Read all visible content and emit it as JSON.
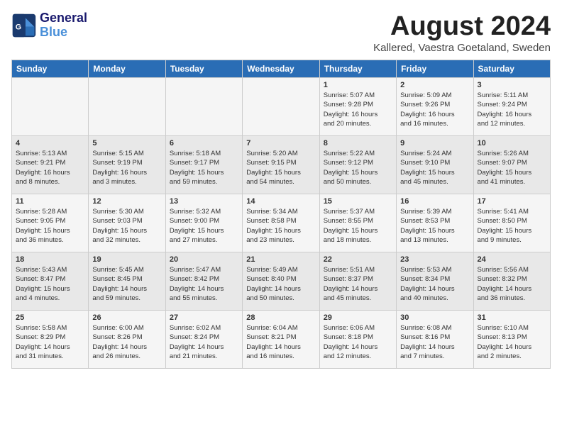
{
  "header": {
    "logo_line1": "General",
    "logo_line2": "Blue",
    "month": "August 2024",
    "location": "Kallered, Vaestra Goetaland, Sweden"
  },
  "days_of_week": [
    "Sunday",
    "Monday",
    "Tuesday",
    "Wednesday",
    "Thursday",
    "Friday",
    "Saturday"
  ],
  "weeks": [
    [
      {
        "day": "",
        "content": ""
      },
      {
        "day": "",
        "content": ""
      },
      {
        "day": "",
        "content": ""
      },
      {
        "day": "",
        "content": ""
      },
      {
        "day": "1",
        "content": "Sunrise: 5:07 AM\nSunset: 9:28 PM\nDaylight: 16 hours\nand 20 minutes."
      },
      {
        "day": "2",
        "content": "Sunrise: 5:09 AM\nSunset: 9:26 PM\nDaylight: 16 hours\nand 16 minutes."
      },
      {
        "day": "3",
        "content": "Sunrise: 5:11 AM\nSunset: 9:24 PM\nDaylight: 16 hours\nand 12 minutes."
      }
    ],
    [
      {
        "day": "4",
        "content": "Sunrise: 5:13 AM\nSunset: 9:21 PM\nDaylight: 16 hours\nand 8 minutes."
      },
      {
        "day": "5",
        "content": "Sunrise: 5:15 AM\nSunset: 9:19 PM\nDaylight: 16 hours\nand 3 minutes."
      },
      {
        "day": "6",
        "content": "Sunrise: 5:18 AM\nSunset: 9:17 PM\nDaylight: 15 hours\nand 59 minutes."
      },
      {
        "day": "7",
        "content": "Sunrise: 5:20 AM\nSunset: 9:15 PM\nDaylight: 15 hours\nand 54 minutes."
      },
      {
        "day": "8",
        "content": "Sunrise: 5:22 AM\nSunset: 9:12 PM\nDaylight: 15 hours\nand 50 minutes."
      },
      {
        "day": "9",
        "content": "Sunrise: 5:24 AM\nSunset: 9:10 PM\nDaylight: 15 hours\nand 45 minutes."
      },
      {
        "day": "10",
        "content": "Sunrise: 5:26 AM\nSunset: 9:07 PM\nDaylight: 15 hours\nand 41 minutes."
      }
    ],
    [
      {
        "day": "11",
        "content": "Sunrise: 5:28 AM\nSunset: 9:05 PM\nDaylight: 15 hours\nand 36 minutes."
      },
      {
        "day": "12",
        "content": "Sunrise: 5:30 AM\nSunset: 9:03 PM\nDaylight: 15 hours\nand 32 minutes."
      },
      {
        "day": "13",
        "content": "Sunrise: 5:32 AM\nSunset: 9:00 PM\nDaylight: 15 hours\nand 27 minutes."
      },
      {
        "day": "14",
        "content": "Sunrise: 5:34 AM\nSunset: 8:58 PM\nDaylight: 15 hours\nand 23 minutes."
      },
      {
        "day": "15",
        "content": "Sunrise: 5:37 AM\nSunset: 8:55 PM\nDaylight: 15 hours\nand 18 minutes."
      },
      {
        "day": "16",
        "content": "Sunrise: 5:39 AM\nSunset: 8:53 PM\nDaylight: 15 hours\nand 13 minutes."
      },
      {
        "day": "17",
        "content": "Sunrise: 5:41 AM\nSunset: 8:50 PM\nDaylight: 15 hours\nand 9 minutes."
      }
    ],
    [
      {
        "day": "18",
        "content": "Sunrise: 5:43 AM\nSunset: 8:47 PM\nDaylight: 15 hours\nand 4 minutes."
      },
      {
        "day": "19",
        "content": "Sunrise: 5:45 AM\nSunset: 8:45 PM\nDaylight: 14 hours\nand 59 minutes."
      },
      {
        "day": "20",
        "content": "Sunrise: 5:47 AM\nSunset: 8:42 PM\nDaylight: 14 hours\nand 55 minutes."
      },
      {
        "day": "21",
        "content": "Sunrise: 5:49 AM\nSunset: 8:40 PM\nDaylight: 14 hours\nand 50 minutes."
      },
      {
        "day": "22",
        "content": "Sunrise: 5:51 AM\nSunset: 8:37 PM\nDaylight: 14 hours\nand 45 minutes."
      },
      {
        "day": "23",
        "content": "Sunrise: 5:53 AM\nSunset: 8:34 PM\nDaylight: 14 hours\nand 40 minutes."
      },
      {
        "day": "24",
        "content": "Sunrise: 5:56 AM\nSunset: 8:32 PM\nDaylight: 14 hours\nand 36 minutes."
      }
    ],
    [
      {
        "day": "25",
        "content": "Sunrise: 5:58 AM\nSunset: 8:29 PM\nDaylight: 14 hours\nand 31 minutes."
      },
      {
        "day": "26",
        "content": "Sunrise: 6:00 AM\nSunset: 8:26 PM\nDaylight: 14 hours\nand 26 minutes."
      },
      {
        "day": "27",
        "content": "Sunrise: 6:02 AM\nSunset: 8:24 PM\nDaylight: 14 hours\nand 21 minutes."
      },
      {
        "day": "28",
        "content": "Sunrise: 6:04 AM\nSunset: 8:21 PM\nDaylight: 14 hours\nand 16 minutes."
      },
      {
        "day": "29",
        "content": "Sunrise: 6:06 AM\nSunset: 8:18 PM\nDaylight: 14 hours\nand 12 minutes."
      },
      {
        "day": "30",
        "content": "Sunrise: 6:08 AM\nSunset: 8:16 PM\nDaylight: 14 hours\nand 7 minutes."
      },
      {
        "day": "31",
        "content": "Sunrise: 6:10 AM\nSunset: 8:13 PM\nDaylight: 14 hours\nand 2 minutes."
      }
    ]
  ]
}
